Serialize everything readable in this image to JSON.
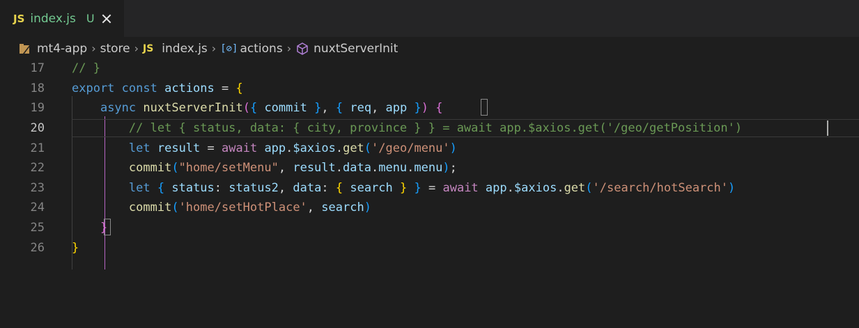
{
  "tab": {
    "badge": "JS",
    "filename": "index.js",
    "status": "U"
  },
  "breadcrumb": {
    "items": [
      "mt4-app",
      "store",
      "index.js",
      "actions",
      "nuxtServerInit"
    ],
    "file_badge": "JS"
  },
  "editor": {
    "active_line": "20",
    "lines": [
      {
        "num": "17",
        "tokens": [
          [
            "cmt",
            "// }"
          ]
        ]
      },
      {
        "num": "18",
        "tokens": [
          [
            "kw",
            "export"
          ],
          [
            "plain",
            " "
          ],
          [
            "kw",
            "const"
          ],
          [
            "plain",
            " "
          ],
          [
            "var",
            "actions"
          ],
          [
            "op",
            " = "
          ],
          [
            "p1",
            "{"
          ]
        ]
      },
      {
        "num": "19",
        "tokens": [
          [
            "plain",
            "    "
          ],
          [
            "kw",
            "async"
          ],
          [
            "plain",
            " "
          ],
          [
            "fn",
            "nuxtServerInit"
          ],
          [
            "p2",
            "("
          ],
          [
            "p3",
            "{"
          ],
          [
            "plain",
            " "
          ],
          [
            "var",
            "commit"
          ],
          [
            "plain",
            " "
          ],
          [
            "p3",
            "}"
          ],
          [
            "plain",
            ", "
          ],
          [
            "p3",
            "{"
          ],
          [
            "plain",
            " "
          ],
          [
            "var",
            "req"
          ],
          [
            "plain",
            ", "
          ],
          [
            "var",
            "app"
          ],
          [
            "plain",
            " "
          ],
          [
            "p3",
            "}"
          ],
          [
            "p2",
            ")"
          ],
          [
            "plain",
            " "
          ],
          [
            "p2",
            "{"
          ]
        ]
      },
      {
        "num": "20",
        "tokens": [
          [
            "plain",
            "        "
          ],
          [
            "cmt",
            "// let { status, data: { city, province } } = await app.$axios.get('/geo/getPosition')"
          ]
        ]
      },
      {
        "num": "21",
        "tokens": [
          [
            "plain",
            "        "
          ],
          [
            "kw",
            "let"
          ],
          [
            "plain",
            " "
          ],
          [
            "var",
            "result"
          ],
          [
            "op",
            " = "
          ],
          [
            "ctl",
            "await"
          ],
          [
            "plain",
            " "
          ],
          [
            "var",
            "app"
          ],
          [
            "plain",
            "."
          ],
          [
            "var",
            "$axios"
          ],
          [
            "plain",
            "."
          ],
          [
            "fn",
            "get"
          ],
          [
            "p3",
            "("
          ],
          [
            "str",
            "'/geo/menu'"
          ],
          [
            "p3",
            ")"
          ]
        ]
      },
      {
        "num": "22",
        "tokens": [
          [
            "plain",
            "        "
          ],
          [
            "fn",
            "commit"
          ],
          [
            "p3",
            "("
          ],
          [
            "str",
            "\"home/setMenu\""
          ],
          [
            "plain",
            ", "
          ],
          [
            "var",
            "result"
          ],
          [
            "plain",
            "."
          ],
          [
            "var",
            "data"
          ],
          [
            "plain",
            "."
          ],
          [
            "var",
            "menu"
          ],
          [
            "plain",
            "."
          ],
          [
            "var",
            "menu"
          ],
          [
            "p3",
            ")"
          ],
          [
            "plain",
            ";"
          ]
        ]
      },
      {
        "num": "23",
        "tokens": [
          [
            "plain",
            "        "
          ],
          [
            "kw",
            "let"
          ],
          [
            "plain",
            " "
          ],
          [
            "p3",
            "{"
          ],
          [
            "plain",
            " "
          ],
          [
            "var",
            "status"
          ],
          [
            "plain",
            ": "
          ],
          [
            "var",
            "status2"
          ],
          [
            "plain",
            ", "
          ],
          [
            "var",
            "data"
          ],
          [
            "plain",
            ": "
          ],
          [
            "p1",
            "{"
          ],
          [
            "plain",
            " "
          ],
          [
            "var",
            "search"
          ],
          [
            "plain",
            " "
          ],
          [
            "p1",
            "}"
          ],
          [
            "plain",
            " "
          ],
          [
            "p3",
            "}"
          ],
          [
            "op",
            " = "
          ],
          [
            "ctl",
            "await"
          ],
          [
            "plain",
            " "
          ],
          [
            "var",
            "app"
          ],
          [
            "plain",
            "."
          ],
          [
            "var",
            "$axios"
          ],
          [
            "plain",
            "."
          ],
          [
            "fn",
            "get"
          ],
          [
            "p3",
            "("
          ],
          [
            "str",
            "'/search/hotSearch'"
          ],
          [
            "p3",
            ")"
          ]
        ]
      },
      {
        "num": "24",
        "tokens": [
          [
            "plain",
            "        "
          ],
          [
            "fn",
            "commit"
          ],
          [
            "p3",
            "("
          ],
          [
            "str",
            "'home/setHotPlace'"
          ],
          [
            "plain",
            ", "
          ],
          [
            "var",
            "search"
          ],
          [
            "p3",
            ")"
          ]
        ]
      },
      {
        "num": "25",
        "tokens": [
          [
            "plain",
            "    "
          ],
          [
            "p2",
            "}"
          ]
        ]
      },
      {
        "num": "26",
        "tokens": [
          [
            "p1",
            "}"
          ]
        ]
      }
    ]
  }
}
